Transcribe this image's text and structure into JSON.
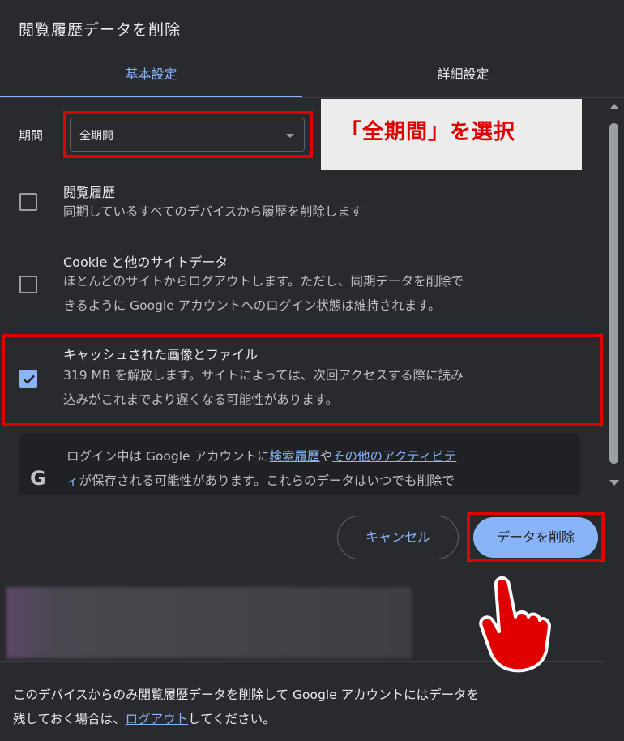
{
  "dialog": {
    "title": "閲覧履歴データを削除",
    "tabs": [
      {
        "label": "基本設定",
        "active": true
      },
      {
        "label": "詳細設定",
        "active": false
      }
    ]
  },
  "period": {
    "label": "期間",
    "selected": "全期間"
  },
  "annotation": {
    "callout_text": "「全期間」を選択"
  },
  "items": [
    {
      "title": "閲覧履歴",
      "description": "同期しているすべてのデバイスから履歴を削除します",
      "checked": false
    },
    {
      "title": "Cookie と他のサイトデータ",
      "description_line1": "ほとんどのサイトからログアウトします。ただし、同期データを削除で",
      "description_line2": "きるように Google アカウントへのログイン状態は維持されます。",
      "checked": false
    },
    {
      "title": "キャッシュされた画像とファイル",
      "description_line1": "319 MB を解放します。サイトによっては、次回アクセスする際に読み",
      "description_line2": "込みがこれまでより遅くなる可能性があります。",
      "checked": true
    }
  ],
  "info": {
    "icon": "google-g-icon",
    "text_before": "ログイン中は Google アカウントに",
    "link1": "検索履歴",
    "text_mid": "や",
    "link2a": "その他のアクティビテ",
    "link2b": "ィ",
    "text_after": "が保存される可能性があります。これらのデータはいつでも削除で"
  },
  "buttons": {
    "cancel": "キャンセル",
    "delete": "データを削除"
  },
  "lower": {
    "text_line1": "このデバイスからのみ閲覧履歴データを削除して Google アカウントにはデータを",
    "text_line2_before": "残しておく場合は、",
    "logout_link": "ログアウト",
    "text_line2_after": "してください。"
  },
  "colors": {
    "accent": "#8ab4f8",
    "highlight": "#e00000",
    "background": "#292a2d"
  }
}
